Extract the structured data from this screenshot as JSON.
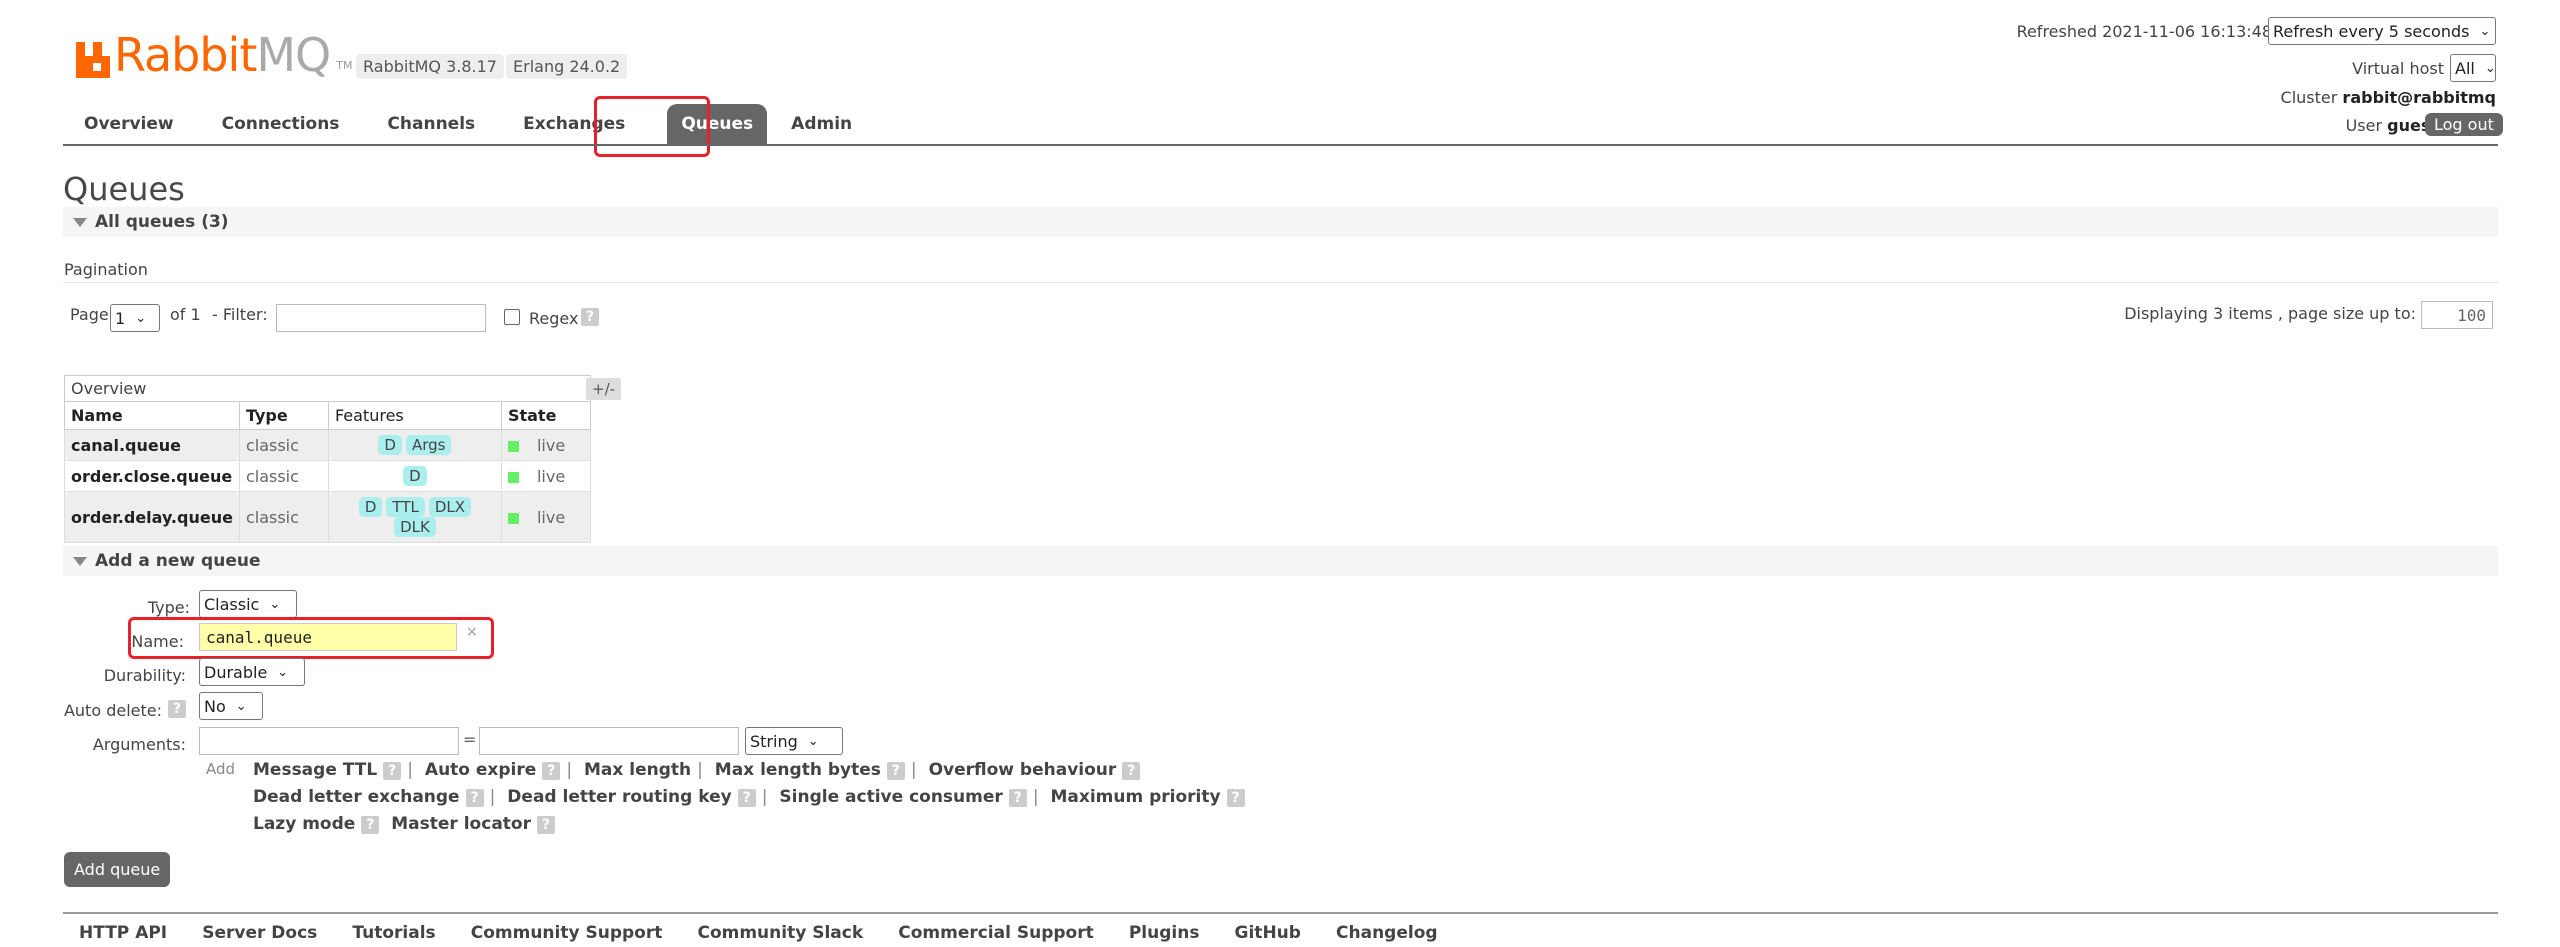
{
  "brand": {
    "rabbit": "Rabbit",
    "mq": "MQ",
    "tm": "TM"
  },
  "versions": {
    "rabbitmq": "RabbitMQ 3.8.17",
    "erlang": "Erlang 24.0.2"
  },
  "nav": {
    "tabs": [
      "Overview",
      "Connections",
      "Channels",
      "Exchanges",
      "Queues",
      "Admin"
    ],
    "active": "Queues"
  },
  "topright": {
    "refreshed": "Refreshed 2021-11-06 16:13:48",
    "refresh_select": "Refresh every 5 seconds",
    "vhost_label": "Virtual host",
    "vhost_value": "All",
    "cluster_label": "Cluster",
    "cluster_value": "rabbit@rabbitmq",
    "user_label": "User",
    "user_value": "guest",
    "logout": "Log out"
  },
  "page_title": "Queues",
  "all_queues": {
    "label": "All queues (3)"
  },
  "pagination": {
    "heading": "Pagination",
    "page_label": "Page",
    "page_value": "1",
    "of_label": "of 1",
    "filter_label": "- Filter:",
    "filter_value": "",
    "regex_label": "Regex",
    "help": "?",
    "displaying": "Displaying 3 items , page size up to:",
    "page_size": "100"
  },
  "table": {
    "group_header": "Overview",
    "plusminus": "+/-",
    "columns": [
      "Name",
      "Type",
      "Features",
      "State"
    ],
    "rows": [
      {
        "name": "canal.queue",
        "type": "classic",
        "features": [
          "D",
          "Args"
        ],
        "state": "live"
      },
      {
        "name": "order.close.queue",
        "type": "classic",
        "features": [
          "D"
        ],
        "state": "live"
      },
      {
        "name": "order.delay.queue",
        "type": "classic",
        "features": [
          "D",
          "TTL",
          "DLX",
          "DLK"
        ],
        "state": "live"
      }
    ]
  },
  "add_queue": {
    "section_label": "Add a new queue",
    "type_label": "Type:",
    "type_value": "Classic",
    "name_label": "Name:",
    "name_value": "canal.queue",
    "name_clear": "×",
    "durability_label": "Durability:",
    "durability_value": "Durable",
    "autodelete_label": "Auto delete:",
    "autodelete_value": "No",
    "arguments_label": "Arguments:",
    "arg_equals": "=",
    "arg_type": "String",
    "add_label": "Add",
    "arg_links": {
      "line1": [
        "Message TTL",
        "Auto expire",
        "Max length",
        "Max length bytes",
        "Overflow behaviour"
      ],
      "line2": [
        "Dead letter exchange",
        "Dead letter routing key",
        "Single active consumer",
        "Maximum priority"
      ],
      "line3": [
        "Lazy mode",
        "Master locator"
      ]
    },
    "submit": "Add queue"
  },
  "footer": {
    "links": [
      "HTTP API",
      "Server Docs",
      "Tutorials",
      "Community Support",
      "Community Slack",
      "Commercial Support",
      "Plugins",
      "GitHub",
      "Changelog"
    ]
  },
  "colors": {
    "brand_orange": "#ff6600",
    "highlight_red": "#e8202a",
    "tab_active": "#666666",
    "feature_badge": "#aaeeee",
    "state_live": "#66ee66"
  }
}
